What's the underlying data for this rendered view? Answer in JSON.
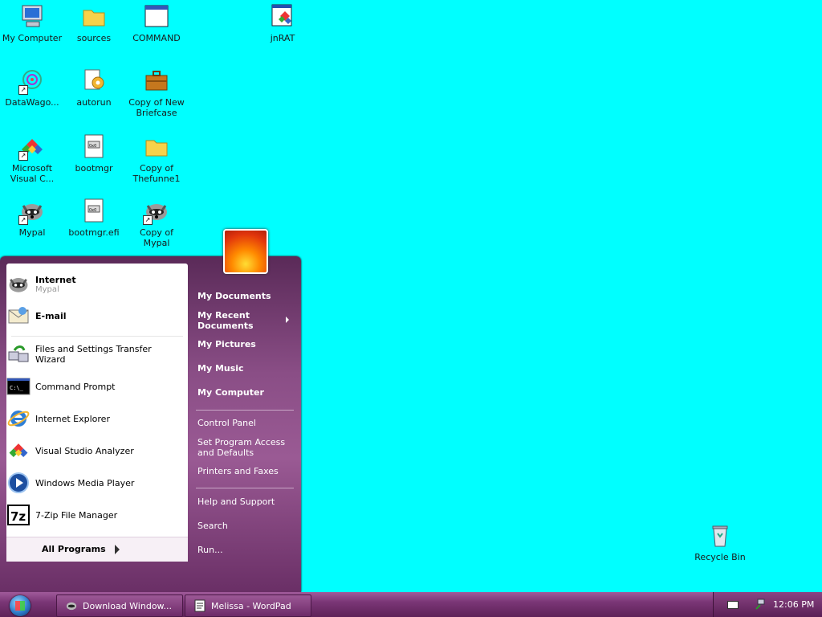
{
  "desktop": {
    "icons": [
      {
        "label": "My Computer"
      },
      {
        "label": "sources"
      },
      {
        "label": "COMMAND"
      },
      {
        "label": "jnRAT"
      },
      {
        "label": "DataWago..."
      },
      {
        "label": "autorun"
      },
      {
        "label": "Copy of New Briefcase"
      },
      {
        "label": "Microsoft Visual C..."
      },
      {
        "label": "bootmgr"
      },
      {
        "label": "Copy of Thefunne1"
      },
      {
        "label": "Mypal"
      },
      {
        "label": "bootmgr.efi"
      },
      {
        "label": "Copy of Mypal"
      },
      {
        "label": "Recycle Bin"
      }
    ]
  },
  "start_menu": {
    "pinned": [
      {
        "label": "Internet",
        "sublabel": "Mypal"
      },
      {
        "label": "E-mail"
      }
    ],
    "recent": [
      {
        "label": "Files and Settings Transfer Wizard"
      },
      {
        "label": "Command Prompt"
      },
      {
        "label": "Internet Explorer"
      },
      {
        "label": "Visual Studio Analyzer"
      },
      {
        "label": "Windows Media Player"
      },
      {
        "label": "7-Zip File Manager"
      }
    ],
    "all_programs": "All Programs",
    "right": {
      "my_documents": "My Documents",
      "my_recent_documents": "My Recent Documents",
      "my_pictures": "My Pictures",
      "my_music": "My Music",
      "my_computer": "My Computer",
      "control_panel": "Control Panel",
      "set_program_access": "Set Program Access and Defaults",
      "printers_faxes": "Printers and Faxes",
      "help_support": "Help and Support",
      "search": "Search",
      "run": "Run..."
    }
  },
  "taskbar": {
    "buttons": [
      {
        "label": "Download Window..."
      },
      {
        "label": "Melissa - WordPad"
      }
    ],
    "clock": "12:06 PM"
  },
  "colors": {
    "desktop_bg": "#00ffff",
    "start_menu_purple": "#8a4e86",
    "taskbar_purple": "#7a3676"
  }
}
